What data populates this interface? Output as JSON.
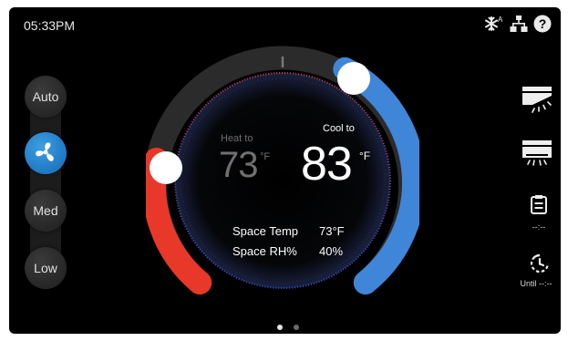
{
  "topbar": {
    "time": "05:33PM",
    "icons": [
      "auto-snowflake-icon",
      "network-icon",
      "help-icon"
    ]
  },
  "fan": {
    "modes": [
      {
        "label": "Auto",
        "icon": null
      },
      {
        "label": "",
        "icon": "fan-icon",
        "active": true
      },
      {
        "label": "Med",
        "icon": null
      },
      {
        "label": "Low",
        "icon": null
      }
    ]
  },
  "dial": {
    "heat_label": "Heat to",
    "heat_value": "73",
    "heat_unit": "°F",
    "cool_label": "Cool to",
    "cool_value": "83",
    "cool_unit": "°F",
    "space_temp_label": "Space Temp",
    "space_temp_value": "73°F",
    "space_rh_label": "Space RH%",
    "space_rh_value": "40%",
    "colors": {
      "heat": "#e8382a",
      "cool": "#3f86d8"
    }
  },
  "right": {
    "icons": [
      "louver-up-icon",
      "louver-down-icon",
      "schedule-icon",
      "timer-icon"
    ],
    "schedule_text": "--:--",
    "timer_text": "Until --:--"
  },
  "pagination": {
    "pages": 2,
    "current": 1
  }
}
